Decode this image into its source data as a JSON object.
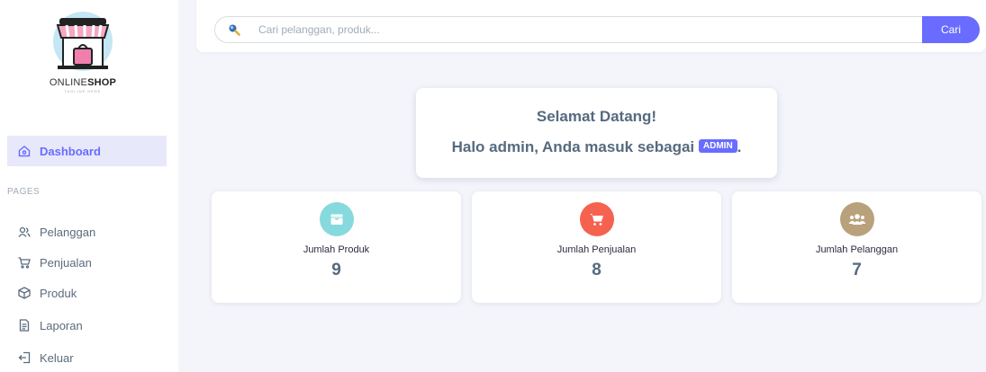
{
  "brand": {
    "name_part1": "ONLINE",
    "name_part2": "SHOP",
    "tagline": "TAGLINE HERE"
  },
  "sidebar": {
    "active_item": {
      "label": "Dashboard",
      "icon": "home-icon"
    },
    "section_label": "PAGES",
    "items": [
      {
        "label": "Pelanggan",
        "icon": "users-icon"
      },
      {
        "label": "Penjualan",
        "icon": "cart-icon"
      },
      {
        "label": "Produk",
        "icon": "box-icon"
      },
      {
        "label": "Laporan",
        "icon": "file-icon"
      },
      {
        "label": "Keluar",
        "icon": "logout-icon"
      }
    ]
  },
  "search": {
    "placeholder": "Cari pelanggan, produk...",
    "value": "",
    "button_label": "Cari"
  },
  "welcome": {
    "title": "Selamat Datang!",
    "greeting": "Halo admin, Anda masuk sebagai",
    "role": "ADMIN",
    "suffix": "."
  },
  "stats": [
    {
      "label": "Jumlah Produk",
      "value": "9",
      "icon": "box-icon",
      "color": "#86d9dc"
    },
    {
      "label": "Jumlah Penjualan",
      "value": "8",
      "icon": "cart-icon",
      "color": "#f5624f"
    },
    {
      "label": "Jumlah Pelanggan",
      "value": "7",
      "icon": "users-icon",
      "color": "#b9a17b"
    }
  ],
  "colors": {
    "accent": "#696cff",
    "active_bg": "#e8e8fb",
    "page_bg": "#f4f5fb"
  }
}
